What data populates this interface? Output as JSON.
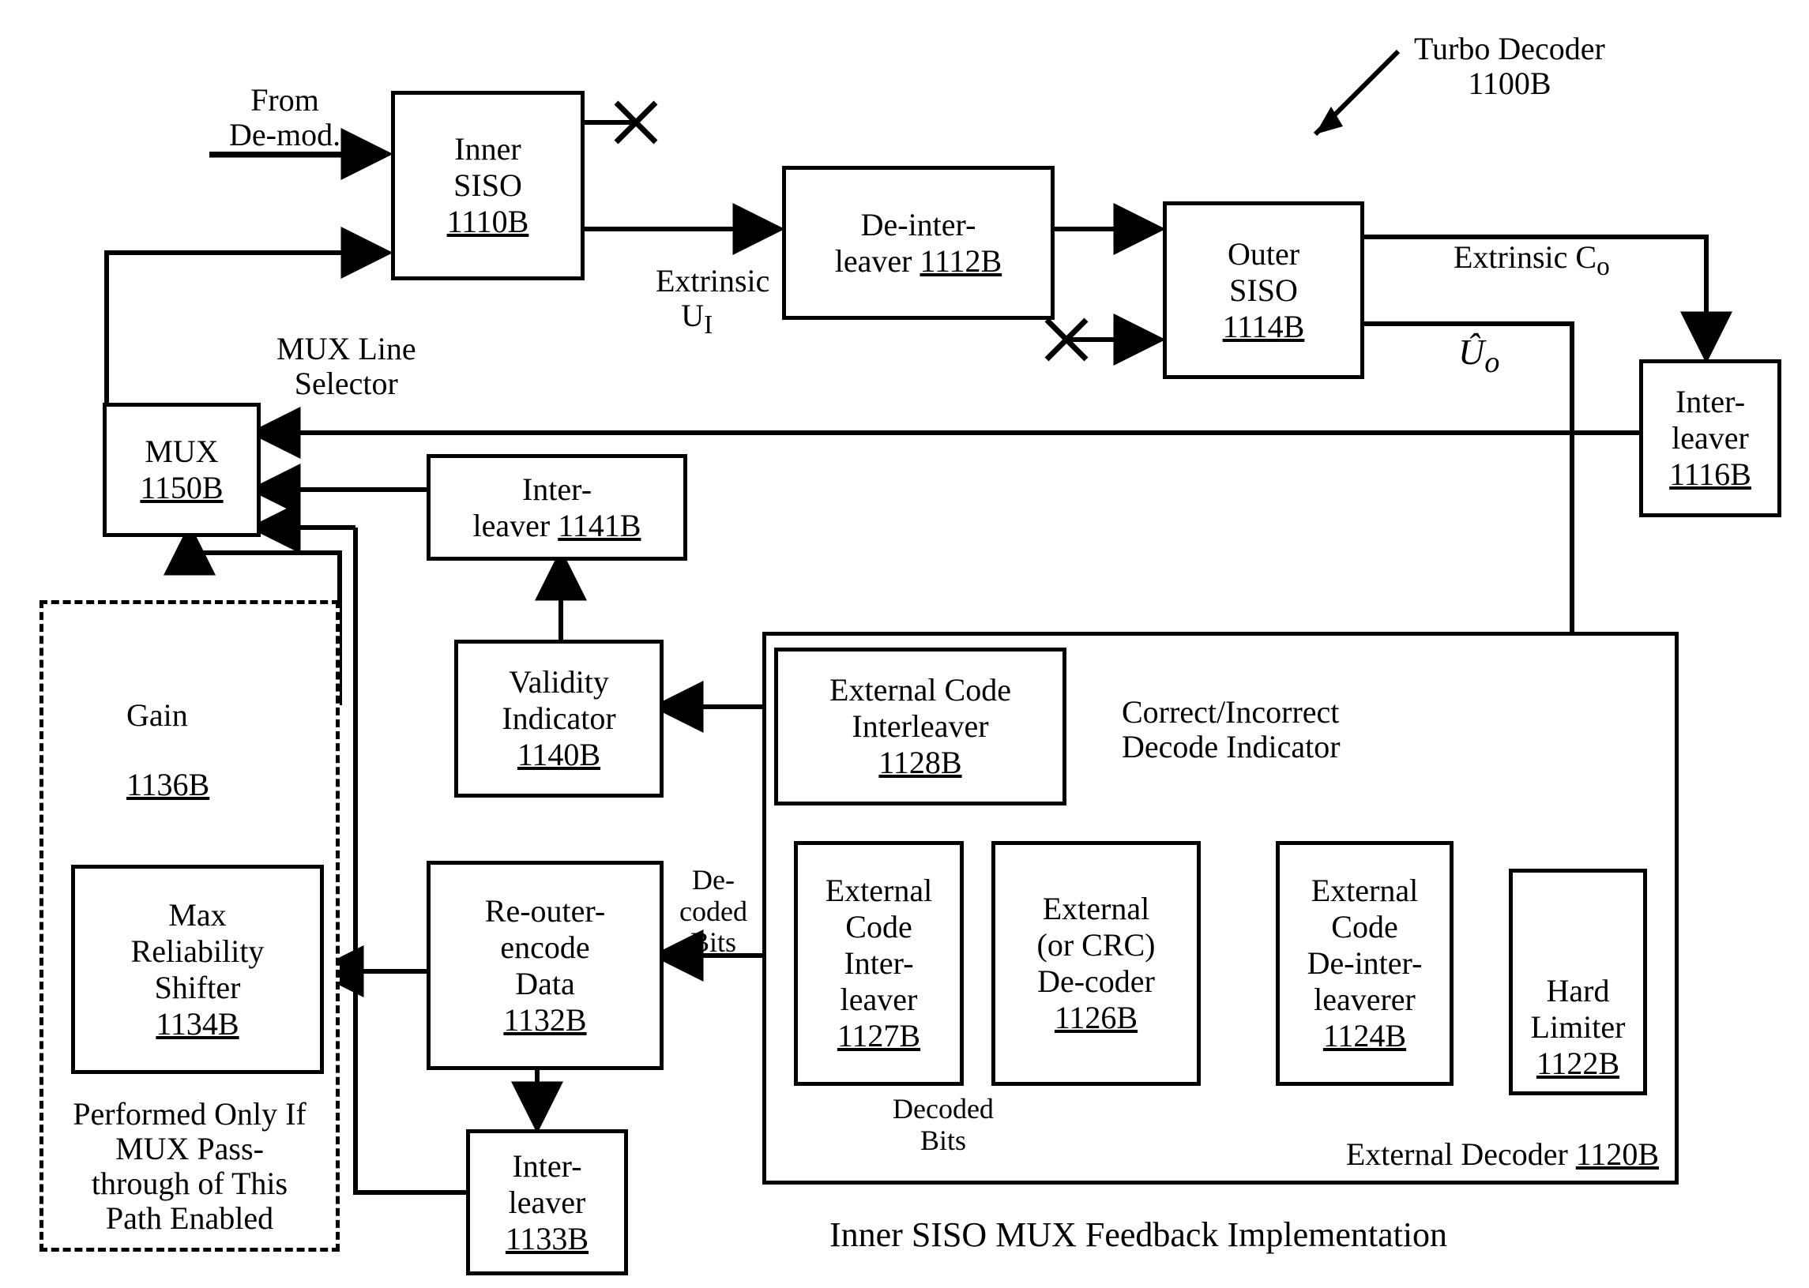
{
  "title_callout": "Turbo Decoder\n1100B",
  "caption": "Inner SISO MUX Feedback Implementation",
  "from_demod": "From\nDe-mod.",
  "mux_line_sel": "MUX Line\nSelector",
  "extrinsic_ui": "Extrinsic\nU",
  "extrinsic_ui_sub": "I",
  "extrinsic_co": "Extrinsic C",
  "extrinsic_co_sub": "o",
  "u_hat": "Û",
  "u_hat_sub": "o",
  "corr_incorr": "Correct/Incorrect\nDecode Indicator",
  "decoded_bits_v": "De-\ncoded\nBits",
  "decoded_bits_h": "Decoded\nBits",
  "dashed_note": "Performed Only If\nMUX Pass-\nthrough of This\nPath Enabled",
  "ext_decoder_label": "External Decoder",
  "ext_decoder_ref": "1120B",
  "gain_label": "Gain",
  "gain_ref": "1136B",
  "boxes": {
    "inner_siso": {
      "lines": [
        "Inner",
        "SISO"
      ],
      "ref": "1110B"
    },
    "deinterleaver": {
      "lines": [
        "De-inter-",
        "leaver "
      ],
      "ref": "1112B",
      "ref_inline": true
    },
    "outer_siso": {
      "lines": [
        "Outer",
        "SISO"
      ],
      "ref": "1114B"
    },
    "interleaver_1116": {
      "lines": [
        "Inter-",
        "leaver"
      ],
      "ref": "1116B"
    },
    "mux": {
      "lines": [
        "MUX"
      ],
      "ref": "1150B"
    },
    "interleaver_1141": {
      "lines": [
        "Inter-",
        "leaver "
      ],
      "ref": "1141B",
      "ref_inline": true
    },
    "validity": {
      "lines": [
        "Validity",
        "Indicator"
      ],
      "ref": "1140B"
    },
    "ext_int_1128": {
      "lines": [
        "External Code",
        "Interleaver"
      ],
      "ref": "1128B"
    },
    "ext_int_1127": {
      "lines": [
        "External",
        "Code",
        "Inter-",
        "leaver"
      ],
      "ref": "1127B"
    },
    "ext_dec_1126": {
      "lines": [
        "External",
        "(or CRC)",
        "De-coder"
      ],
      "ref": "1126B"
    },
    "ext_deint_1124": {
      "lines": [
        "External",
        "Code",
        "De-inter-",
        "leaverer"
      ],
      "ref": "1124B"
    },
    "hard_lim": {
      "lines": [
        "Hard",
        "Limiter"
      ],
      "ref": "1122B"
    },
    "reouter": {
      "lines": [
        "Re-outer-",
        "encode",
        "Data"
      ],
      "ref": "1132B"
    },
    "interleaver_1133": {
      "lines": [
        "Inter-",
        "leaver"
      ],
      "ref": "1133B"
    },
    "max_rel": {
      "lines": [
        "Max",
        "Reliability",
        "Shifter"
      ],
      "ref": "1134B"
    }
  }
}
